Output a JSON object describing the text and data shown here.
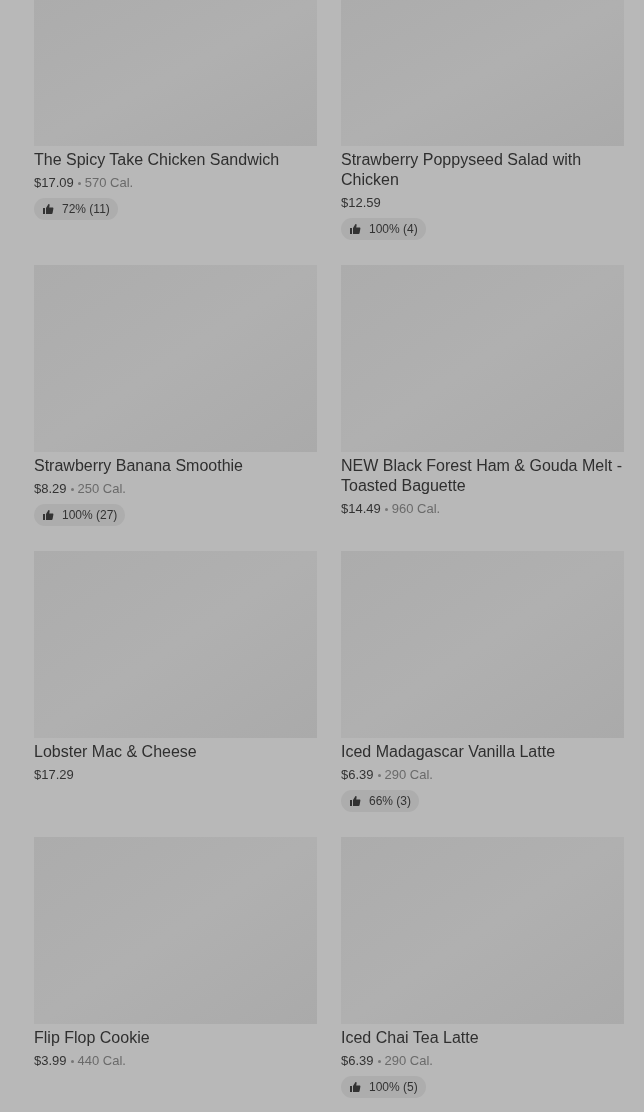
{
  "items": [
    {
      "name": "The Spicy Take Chicken Sandwich",
      "price": "$17.09",
      "calories": "570 Cal.",
      "rating": "72% (11)"
    },
    {
      "name": "Strawberry Poppyseed Salad with Chicken",
      "price": "$12.59",
      "rating": "100% (4)"
    },
    {
      "name": "Strawberry Banana Smoothie",
      "price": "$8.29",
      "calories": "250 Cal.",
      "rating": "100% (27)"
    },
    {
      "name": "NEW Black Forest Ham & Gouda Melt - Toasted Baguette",
      "price": "$14.49",
      "calories": "960 Cal."
    },
    {
      "name": "Lobster Mac & Cheese",
      "price": "$17.29"
    },
    {
      "name": "Iced Madagascar Vanilla Latte",
      "price": "$6.39",
      "calories": "290 Cal.",
      "rating": "66% (3)"
    },
    {
      "name": "Flip Flop Cookie",
      "price": "$3.99",
      "calories": "440 Cal."
    },
    {
      "name": "Iced Chai Tea Latte",
      "price": "$6.39",
      "calories": "290 Cal.",
      "rating": "100% (5)"
    }
  ]
}
